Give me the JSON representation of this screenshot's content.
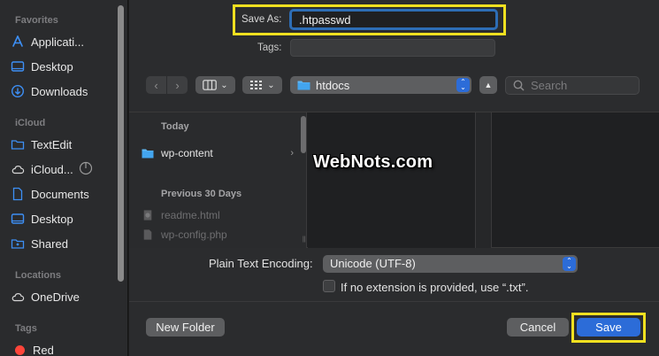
{
  "sidebar": {
    "favorites_heading": "Favorites",
    "favorites": [
      {
        "label": "Applicati...",
        "icon": "applications-icon"
      },
      {
        "label": "Desktop",
        "icon": "desktop-icon"
      },
      {
        "label": "Downloads",
        "icon": "downloads-icon"
      }
    ],
    "icloud_heading": "iCloud",
    "icloud": [
      {
        "label": "TextEdit",
        "icon": "folder-icon"
      },
      {
        "label": "iCloud...",
        "icon": "cloud-icon"
      },
      {
        "label": "Documents",
        "icon": "document-icon"
      },
      {
        "label": "Desktop",
        "icon": "desktop-icon"
      },
      {
        "label": "Shared",
        "icon": "shared-folder-icon"
      }
    ],
    "locations_heading": "Locations",
    "locations": [
      {
        "label": "OneDrive",
        "icon": "cloud-icon"
      }
    ],
    "tags_heading": "Tags",
    "tags": [
      {
        "label": "Red",
        "color": "#ff453a"
      }
    ]
  },
  "save_dialog": {
    "save_as_label": "Save As:",
    "save_as_value": ".htpasswd",
    "tags_label": "Tags:",
    "location": "htdocs",
    "search_placeholder": "Search"
  },
  "browser": {
    "group_today": "Today",
    "today_items": [
      {
        "name": "wp-content",
        "kind": "folder",
        "enabled": true
      }
    ],
    "group_previous": "Previous 30 Days",
    "previous_items": [
      {
        "name": "readme.html",
        "kind": "html",
        "enabled": false
      },
      {
        "name": "wp-config.php",
        "kind": "file",
        "enabled": false
      }
    ]
  },
  "watermark": "WebNots.com",
  "options": {
    "encoding_label": "Plain Text Encoding:",
    "encoding_value": "Unicode (UTF-8)",
    "extension_checkbox_label": "If no extension is provided, use “.txt”.",
    "extension_checked": false
  },
  "buttons": {
    "new_folder": "New Folder",
    "cancel": "Cancel",
    "save": "Save"
  },
  "colors": {
    "accent": "#2c6cd8",
    "highlight": "#f0e020",
    "tag_red": "#ff453a"
  }
}
